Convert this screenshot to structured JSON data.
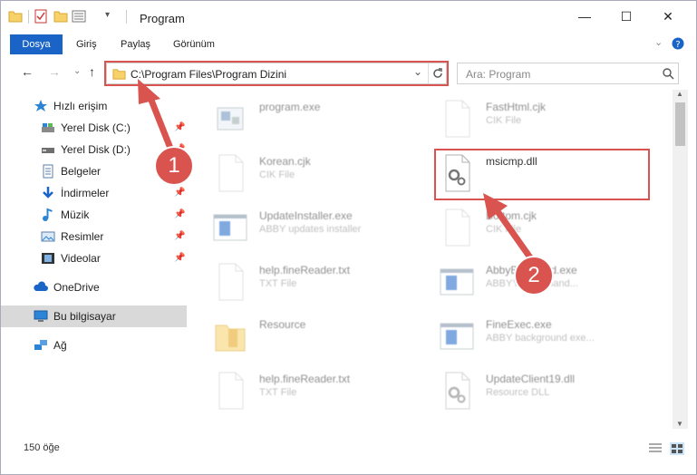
{
  "window": {
    "title": "Program",
    "min": "—",
    "max": "☐",
    "close": "✕"
  },
  "ribbon": {
    "tabs": [
      "Dosya",
      "Giriş",
      "Paylaş",
      "Görünüm"
    ]
  },
  "nav": {
    "back": "←",
    "forward": "→",
    "up_dropdown": "⌄",
    "up": "↑"
  },
  "address": {
    "path": "C:\\Program Files\\Program Dizini"
  },
  "search": {
    "placeholder": "Ara: Program"
  },
  "sidebar": {
    "items": [
      {
        "label": "Hızlı erişim",
        "icon": "star-icon"
      },
      {
        "label": "Yerel Disk (C:)",
        "icon": "drive-icon",
        "pinned": true
      },
      {
        "label": "Yerel Disk (D:)",
        "icon": "drive-icon",
        "pinned": true
      },
      {
        "label": "Belgeler",
        "icon": "documents-icon",
        "pinned": true
      },
      {
        "label": "İndirmeler",
        "icon": "download-icon",
        "pinned": true
      },
      {
        "label": "Müzik",
        "icon": "music-icon",
        "pinned": true
      },
      {
        "label": "Resimler",
        "icon": "pictures-icon",
        "pinned": true
      },
      {
        "label": "Videolar",
        "icon": "videos-icon",
        "pinned": true
      },
      {
        "label": "OneDrive",
        "icon": "cloud-icon"
      },
      {
        "label": "Bu bilgisayar",
        "icon": "computer-icon",
        "selected": true
      },
      {
        "label": "Ağ",
        "icon": "network-icon"
      }
    ]
  },
  "files": [
    {
      "name": "program.exe",
      "desc": "",
      "icon": "exe-icon"
    },
    {
      "name": "FastHtml.cjk",
      "desc": "CIK File",
      "icon": "blank-file-icon"
    },
    {
      "name": "Korean.cjk",
      "desc": "CIK File",
      "icon": "blank-file-icon"
    },
    {
      "name": "msicmp.dll",
      "desc": "",
      "icon": "dll-gear-icon"
    },
    {
      "name": "UpdateInstaller.exe",
      "desc": "ABBY updates installer",
      "icon": "app-window-icon"
    },
    {
      "name": "Bottom.cjk",
      "desc": "CIK File",
      "icon": "blank-file-icon"
    },
    {
      "name": "help.fineReader.txt",
      "desc": "TXT File",
      "icon": "blank-file-icon"
    },
    {
      "name": "AbbyBackgrnd.exe",
      "desc": "ABBYY client hand...",
      "icon": "app-window-icon"
    },
    {
      "name": "Resource",
      "desc": "",
      "icon": "folder-icon"
    },
    {
      "name": "FineExec.exe",
      "desc": "ABBY background exe...",
      "icon": "app-window-icon"
    },
    {
      "name": "help.fineReader.txt",
      "desc": "TXT File",
      "icon": "blank-file-icon"
    },
    {
      "name": "UpdateClient19.dll",
      "desc": "Resource DLL",
      "icon": "dll-gear-icon"
    }
  ],
  "status": {
    "count": "150 öğe"
  },
  "annotations": {
    "marker1": "1",
    "marker2": "2"
  },
  "colors": {
    "accent": "#1a64c8",
    "annotation": "#d9534f",
    "selected_bg": "#d9d9d9"
  }
}
